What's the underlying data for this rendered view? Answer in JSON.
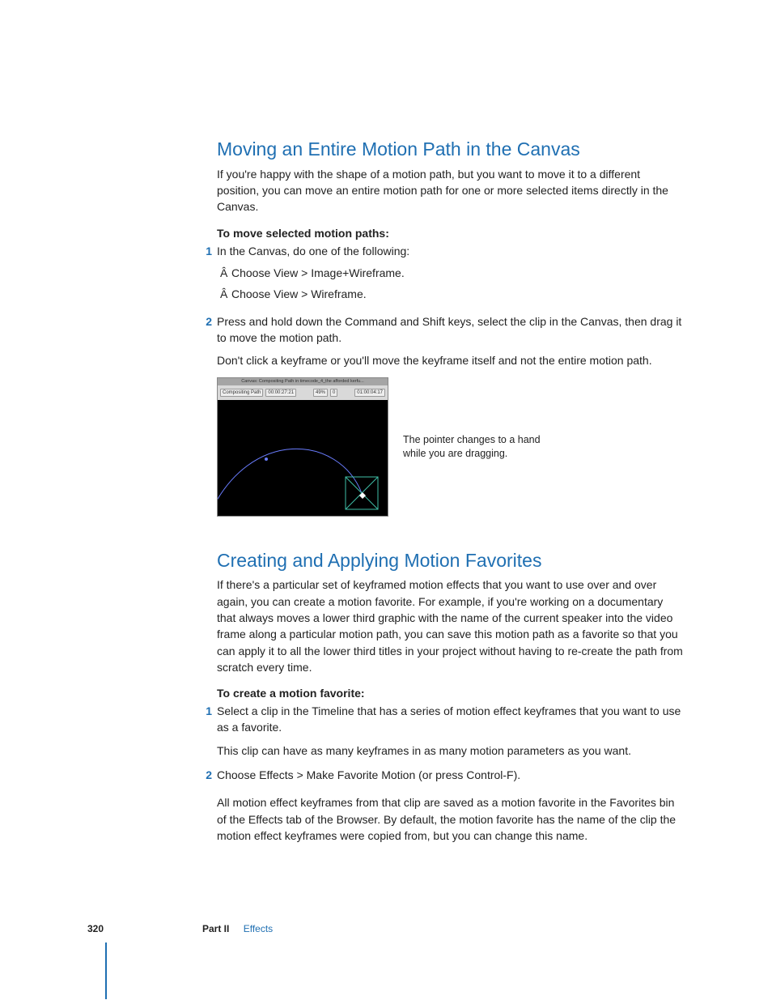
{
  "section1": {
    "heading": "Moving an Entire Motion Path in the Canvas",
    "intro": "If you're happy with the shape of a motion path, but you want to move it to a different position, you can move an entire motion path for one or more selected items directly in the Canvas.",
    "subhead": "To move selected motion paths:",
    "steps": [
      {
        "num": "1",
        "text": "In the Canvas, do one of the following:",
        "bullets": [
          "Choose View > Image+Wireframe.",
          "Choose View > Wireframe."
        ]
      },
      {
        "num": "2",
        "text": "Press and hold down the Command and Shift keys, select the clip in the Canvas, then drag it to move the motion path.",
        "extra": "Don't click a keyframe or you'll move the keyframe itself and not the entire motion path."
      }
    ],
    "figure": {
      "titlebar": "Canvas: Compositing Path in timecode_4_the afforded kerfu...",
      "tab": "Compositing Path",
      "left_tc": "00:00:27:21",
      "mid1": "49%",
      "mid2": "0",
      "right_tc": "01:00:04:17",
      "caption": "The pointer changes to a hand while you are dragging."
    }
  },
  "section2": {
    "heading": "Creating and Applying Motion Favorites",
    "intro": "If there's a particular set of keyframed motion effects that you want to use over and over again, you can create a motion favorite. For example, if you're working on a documentary that always moves a lower third graphic with the name of the current speaker into the video frame along a particular motion path, you can save this motion path as a favorite so that you can apply it to all the lower third titles in your project without having to re-create the path from scratch every time.",
    "subhead": "To create a motion favorite:",
    "steps": [
      {
        "num": "1",
        "text": "Select a clip in the Timeline that has a series of motion effect keyframes that you want to use as a favorite.",
        "extra": "This clip can have as many keyframes in as many motion parameters as you want."
      },
      {
        "num": "2",
        "text": "Choose Effects > Make Favorite Motion (or press Control-F).",
        "extra": "All motion effect keyframes from that clip are saved as a motion favorite in the Favorites bin of the Effects tab of the Browser. By default, the motion favorite has the name of the clip the motion effect keyframes were copied from, but you can change this name."
      }
    ]
  },
  "footer": {
    "page": "320",
    "part_label": "Part II",
    "part_name": "Effects"
  }
}
